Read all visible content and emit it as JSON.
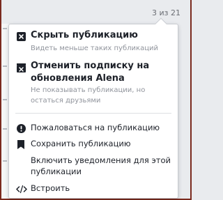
{
  "counter": "3 из 21",
  "menu": {
    "hide": {
      "title": "Скрыть публикацию",
      "subtitle": "Видеть меньше таких публикаций",
      "icon": "close-box-icon"
    },
    "unfollow": {
      "title_line1": "Отменить подписку на",
      "title_line2": "обновления Alena",
      "subtitle_line1": "Не показывать публикации, но",
      "subtitle_line2": "остаться друзьями",
      "icon": "unfollow-icon"
    },
    "report": {
      "label": "Пожаловаться на публикацию",
      "icon": "alert-icon"
    },
    "save": {
      "label": "Сохранить публикацию",
      "icon": "bookmark-icon"
    },
    "notifications": {
      "label_line1": "Включить уведомления для этой",
      "label_line2": "публикации",
      "icon": "bell-icon"
    },
    "embed": {
      "label": "Встроить",
      "icon": "code-icon"
    }
  },
  "colors": {
    "frame": "#7a2a1e",
    "text": "#1d2129",
    "muted": "#90949c",
    "icon": "#4b4f56"
  }
}
